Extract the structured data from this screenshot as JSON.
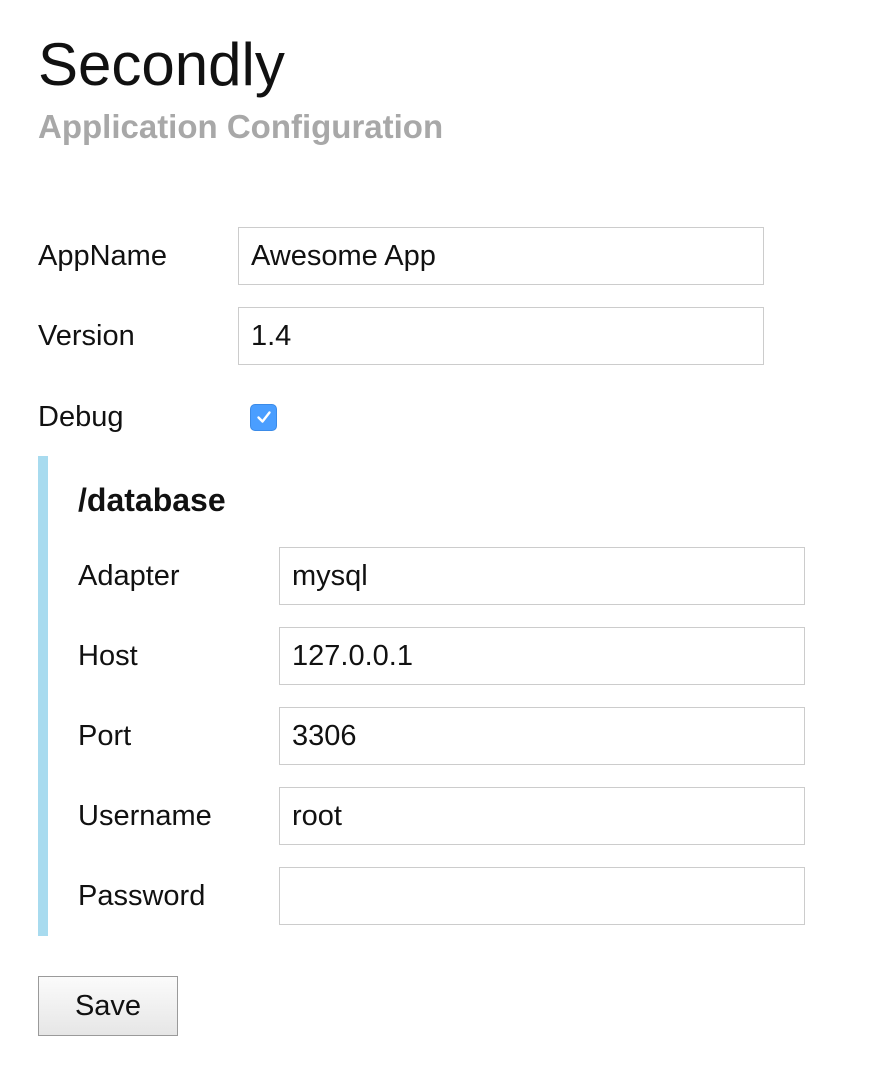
{
  "header": {
    "title": "Secondly",
    "subtitle": "Application Configuration"
  },
  "fields": {
    "appname": {
      "label": "AppName",
      "value": "Awesome App"
    },
    "version": {
      "label": "Version",
      "value": "1.4"
    },
    "debug": {
      "label": "Debug",
      "checked": true
    }
  },
  "database": {
    "title": "/database",
    "adapter": {
      "label": "Adapter",
      "value": "mysql"
    },
    "host": {
      "label": "Host",
      "value": "127.0.0.1"
    },
    "port": {
      "label": "Port",
      "value": "3306"
    },
    "username": {
      "label": "Username",
      "value": "root"
    },
    "password": {
      "label": "Password",
      "value": ""
    }
  },
  "actions": {
    "save_label": "Save"
  },
  "colors": {
    "accent_bar": "#a8dbef",
    "checkbox": "#4a9eff",
    "subtitle": "#a8a8a8"
  },
  "icons": {
    "debug_checkbox": "checkmark-icon"
  }
}
